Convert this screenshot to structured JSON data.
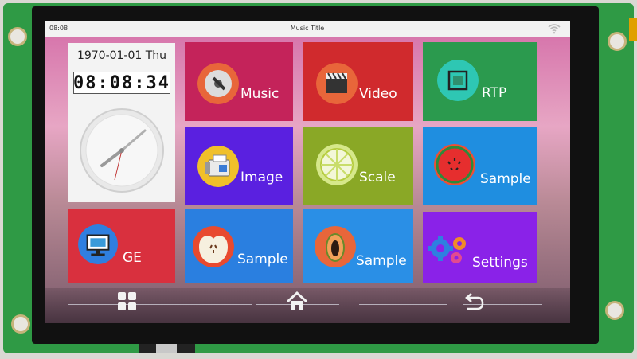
{
  "status_bar": {
    "time": "08:08",
    "title": "Music Title"
  },
  "clock": {
    "date": "1970-01-01 Thu",
    "digital": "08:08:34"
  },
  "tiles": [
    {
      "label": "Music"
    },
    {
      "label": "Video"
    },
    {
      "label": "RTP"
    },
    {
      "label": "Image"
    },
    {
      "label": "Scale"
    },
    {
      "label": "Sample"
    },
    {
      "label": "GE"
    },
    {
      "label": "Sample"
    },
    {
      "label": "Sample"
    },
    {
      "label": "Settings"
    }
  ],
  "icons": [
    "wifi-icon",
    "music-disc-icon",
    "video-clapper-icon",
    "rtp-icon",
    "fax-machine-icon",
    "lime-slice-icon",
    "watermelon-icon",
    "monitor-icon",
    "apple-half-icon",
    "papaya-icon",
    "gears-icon",
    "apps-grid-icon",
    "home-icon",
    "back-arrow-icon"
  ],
  "colors": {
    "music": "#c4235a",
    "video": "#d02a2d",
    "rtp": "#2b9a4e",
    "image": "#5a20e0",
    "scale": "#8aa826",
    "sample1": "#1f8ee0",
    "ge": "#d9303e",
    "sample2": "#2a7fe0",
    "sample3": "#2a8fe6",
    "settings": "#8a22e8"
  }
}
